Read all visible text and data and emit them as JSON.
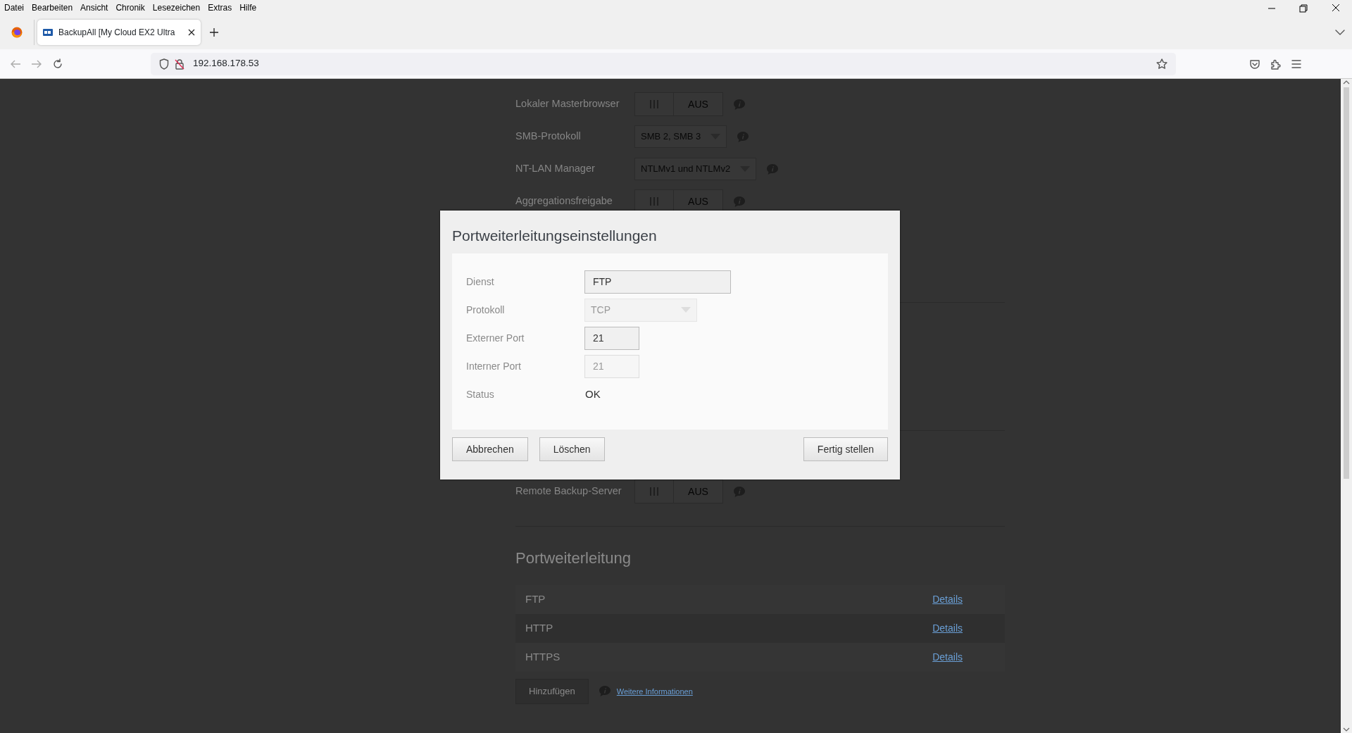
{
  "browser": {
    "menu": [
      "Datei",
      "Bearbeiten",
      "Ansicht",
      "Chronik",
      "Lesezeichen",
      "Extras",
      "Hilfe"
    ],
    "tabs": [
      {
        "title": "BackupAll [My Cloud EX2 Ultra",
        "selected": true
      }
    ],
    "address": "192.168.178.53"
  },
  "settings": [
    {
      "kind": "toggle",
      "label": "Lokaler Masterbrowser",
      "value": "AUS",
      "on": false
    },
    {
      "kind": "select",
      "label": "SMB-Protokoll",
      "value": "SMB 2, SMB 3"
    },
    {
      "kind": "select",
      "label": "NT-LAN Manager",
      "value": "NTLMv1 und NTLMv2"
    },
    {
      "kind": "toggle",
      "label": "Aggregationsfreigabe",
      "value": "AUS",
      "on": false
    }
  ],
  "remote_backup": {
    "kind": "toggle",
    "label": "Remote Backup-Server",
    "value": "AUS",
    "on": false
  },
  "port_forwarding": {
    "title": "Portweiterleitung",
    "rows": [
      {
        "service": "FTP",
        "link": "Details"
      },
      {
        "service": "HTTP",
        "link": "Details"
      },
      {
        "service": "HTTPS",
        "link": "Details"
      }
    ],
    "add_button": "Hinzufügen",
    "more_link": "Weitere Informationen"
  },
  "dialog": {
    "title": "Portweiterleitungseinstellungen",
    "fields": [
      {
        "kind": "input",
        "label": "Dienst",
        "value": "FTP",
        "disabled": false
      },
      {
        "kind": "select",
        "label": "Protokoll",
        "value": "TCP",
        "disabled": true
      },
      {
        "kind": "input",
        "label": "Externer Port",
        "value": "21",
        "disabled": false
      },
      {
        "kind": "input",
        "label": "Interner Port",
        "value": "21",
        "disabled": true
      },
      {
        "kind": "text",
        "label": "Status",
        "value": "OK"
      }
    ],
    "buttons": [
      "Abbrechen",
      "Löschen",
      "Fertig stellen"
    ]
  }
}
